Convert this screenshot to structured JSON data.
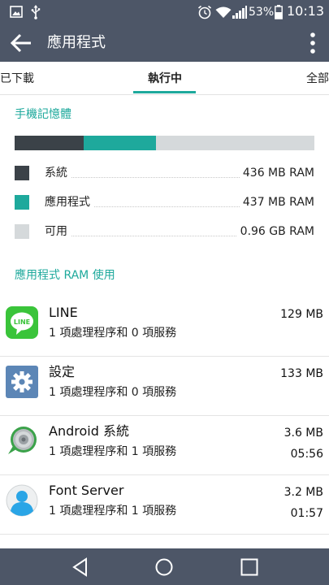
{
  "status_bar": {
    "battery": "53%",
    "time": "10:13",
    "icons": [
      "image-icon",
      "usb-icon",
      "alarm-icon",
      "wifi-icon",
      "signal-icon",
      "battery-icon"
    ]
  },
  "app_bar": {
    "title": "應用程式",
    "back_icon": "arrow-left-icon",
    "menu_icon": "more-vert-icon"
  },
  "tabs": [
    {
      "label": "已下載",
      "active": false
    },
    {
      "label": "執行中",
      "active": true
    },
    {
      "label": "全部",
      "active": false
    }
  ],
  "memory": {
    "title": "手機記憶體",
    "bar_fractions": [
      0.23,
      0.24,
      0.53
    ],
    "items": [
      {
        "label": "系統",
        "value": "436 MB RAM",
        "color": "#3b4248"
      },
      {
        "label": "應用程式",
        "value": "437 MB RAM",
        "color": "#1ea99c"
      },
      {
        "label": "可用",
        "value": "0.96 GB RAM",
        "color": "#d5d9db"
      }
    ]
  },
  "app_ram": {
    "title": "應用程式 RAM 使用",
    "apps": [
      {
        "name": "LINE",
        "sub": "1 項處理程序和 0 項服務",
        "size": "129 MB",
        "time": "",
        "icon": "line-app-icon"
      },
      {
        "name": "設定",
        "sub": "1 項處理程序和 0 項服務",
        "size": "133 MB",
        "time": "",
        "icon": "settings-gear-icon"
      },
      {
        "name": "Android 系統",
        "sub": "1 項處理程序和 1 項服務",
        "size": "3.6 MB",
        "time": "05:56",
        "icon": "android-system-icon"
      },
      {
        "name": "Font Server",
        "sub": "1 項處理程序和 1 項服務",
        "size": "3.2 MB",
        "time": "01:57",
        "icon": "font-server-user-icon"
      }
    ]
  },
  "colors": {
    "bar_bg": "#4d5667",
    "accent": "#1ea99c"
  }
}
